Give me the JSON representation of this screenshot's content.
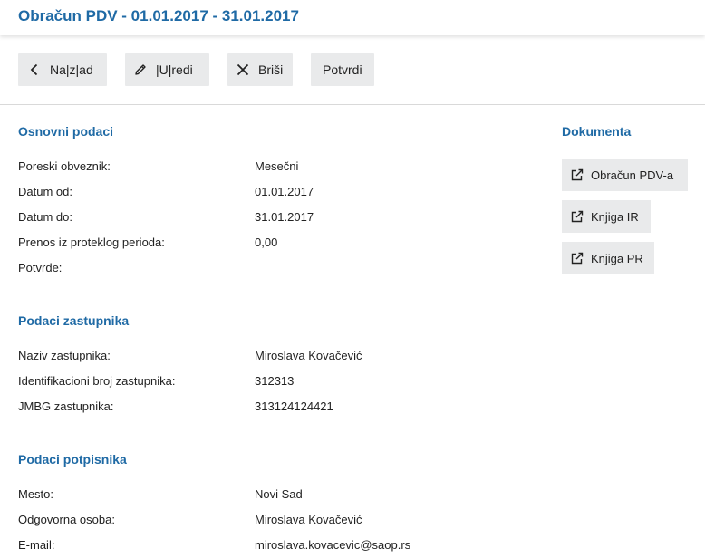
{
  "header": {
    "title": "Obračun PDV - 01.01.2017 - 31.01.2017"
  },
  "toolbar": {
    "back_label": "Na|z|ad",
    "edit_label": "|U|redi",
    "delete_label": "Briši",
    "confirm_label": "Potvrdi"
  },
  "basic": {
    "title": "Osnovni podaci",
    "rows": [
      {
        "label": "Poreski obveznik:",
        "value": "Mesečni"
      },
      {
        "label": "Datum od:",
        "value": "01.01.2017"
      },
      {
        "label": "Datum do:",
        "value": "31.01.2017"
      },
      {
        "label": "Prenos iz proteklog perioda:",
        "value": "0,00"
      },
      {
        "label": "Potvrde:",
        "value": ""
      }
    ]
  },
  "representative": {
    "title": "Podaci zastupnika",
    "rows": [
      {
        "label": "Naziv zastupnika:",
        "value": "Miroslava Kovačević"
      },
      {
        "label": "Identifikacioni broj zastupnika:",
        "value": "312313"
      },
      {
        "label": "JMBG zastupnika:",
        "value": "313124124421"
      }
    ]
  },
  "signatory": {
    "title": "Podaci potpisnika",
    "rows": [
      {
        "label": "Mesto:",
        "value": "Novi Sad"
      },
      {
        "label": "Odgovorna osoba:",
        "value": "Miroslava Kovačević"
      },
      {
        "label": "E-mail:",
        "value": "miroslava.kovacevic@saop.rs"
      }
    ]
  },
  "documents": {
    "title": "Dokumenta",
    "items": [
      {
        "label": "Obračun PDV-a",
        "icon": "external-link-icon"
      },
      {
        "label": "Knjiga IR",
        "icon": "external-link-icon"
      },
      {
        "label": "Knjiga PR",
        "icon": "external-link-icon"
      }
    ]
  },
  "colors": {
    "accent": "#1f6aa5",
    "button_bg": "#e9eaeb",
    "divider": "#d9d9d9"
  }
}
